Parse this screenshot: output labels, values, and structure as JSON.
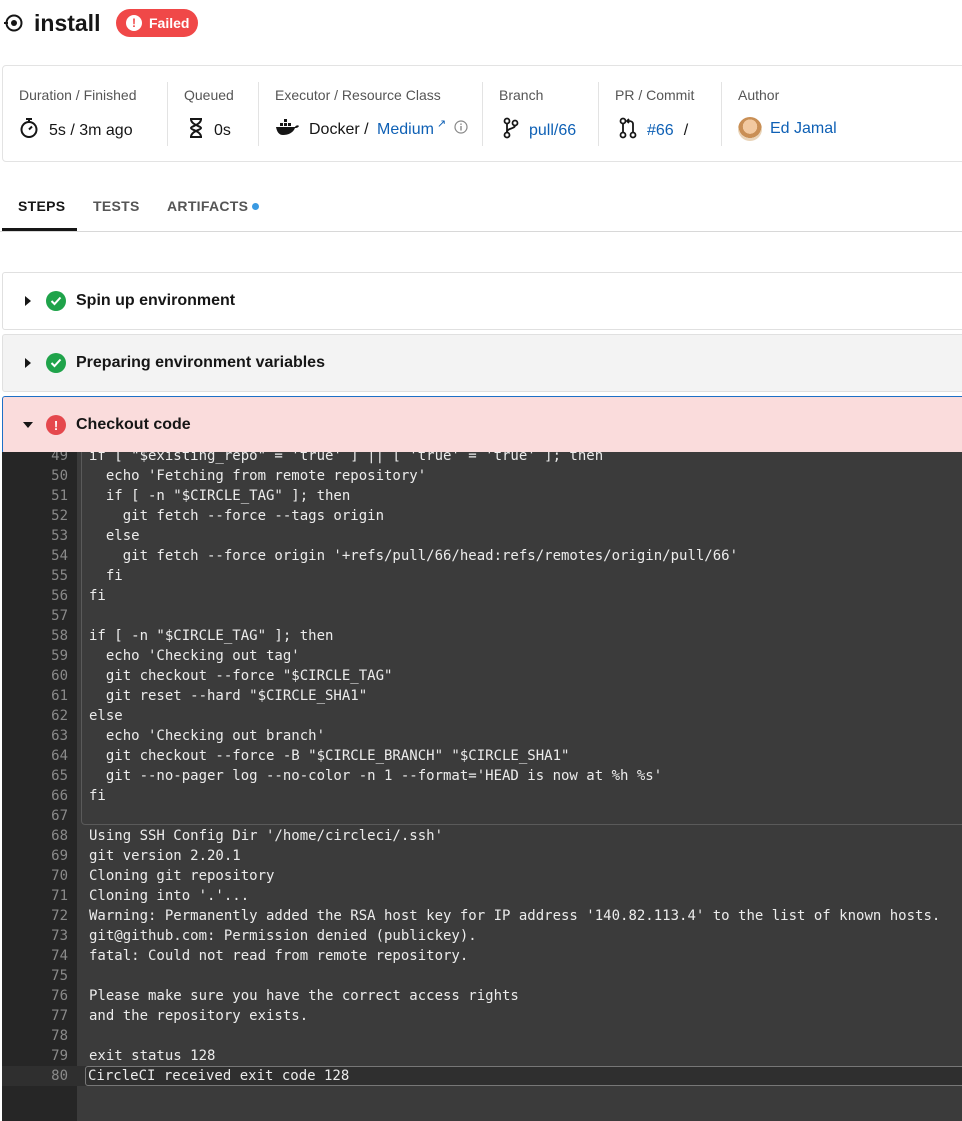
{
  "job": {
    "title": "install",
    "status": "Failed",
    "status_color": "#f04848"
  },
  "info": {
    "duration": {
      "label": "Duration / Finished",
      "value": "5s / 3m ago"
    },
    "queued": {
      "label": "Queued",
      "value": "0s"
    },
    "executor": {
      "label": "Executor / Resource Class",
      "value": "Docker / ",
      "resource_class": "Medium"
    },
    "branch": {
      "label": "Branch",
      "value": "pull/66"
    },
    "pr_commit": {
      "label": "PR / Commit",
      "pr": "#66",
      "sep": "/"
    },
    "author": {
      "label": "Author",
      "name": "Ed Jamal"
    }
  },
  "tabs": [
    {
      "label": "STEPS",
      "active": true
    },
    {
      "label": "TESTS",
      "active": false
    },
    {
      "label": "ARTIFACTS",
      "active": false,
      "has_dot": true
    }
  ],
  "steps": [
    {
      "name": "Spin up environment",
      "status": "success",
      "expanded": false
    },
    {
      "name": "Preparing environment variables",
      "status": "success",
      "expanded": false
    },
    {
      "name": "Checkout code",
      "status": "failed",
      "expanded": true
    }
  ],
  "colors": {
    "success": "#1fa34a",
    "failed": "#e5484d",
    "failed_bg": "#fadcdc",
    "link": "#0e60b5",
    "terminal_bg": "#3b3b3b"
  },
  "log_lines": [
    {
      "n": "49",
      "t": "if [ \"$existing_repo\" = 'true' ] || [ 'true' = 'true' ]; then"
    },
    {
      "n": "50",
      "t": "  echo 'Fetching from remote repository'"
    },
    {
      "n": "51",
      "t": "  if [ -n \"$CIRCLE_TAG\" ]; then"
    },
    {
      "n": "52",
      "t": "    git fetch --force --tags origin"
    },
    {
      "n": "53",
      "t": "  else"
    },
    {
      "n": "54",
      "t": "    git fetch --force origin '+refs/pull/66/head:refs/remotes/origin/pull/66'"
    },
    {
      "n": "55",
      "t": "  fi"
    },
    {
      "n": "56",
      "t": "fi"
    },
    {
      "n": "57",
      "t": ""
    },
    {
      "n": "58",
      "t": "if [ -n \"$CIRCLE_TAG\" ]; then"
    },
    {
      "n": "59",
      "t": "  echo 'Checking out tag'"
    },
    {
      "n": "60",
      "t": "  git checkout --force \"$CIRCLE_TAG\""
    },
    {
      "n": "61",
      "t": "  git reset --hard \"$CIRCLE_SHA1\""
    },
    {
      "n": "62",
      "t": "else"
    },
    {
      "n": "63",
      "t": "  echo 'Checking out branch'"
    },
    {
      "n": "64",
      "t": "  git checkout --force -B \"$CIRCLE_BRANCH\" \"$CIRCLE_SHA1\""
    },
    {
      "n": "65",
      "t": "  git --no-pager log --no-color -n 1 --format='HEAD is now at %h %s'"
    },
    {
      "n": "66",
      "t": "fi"
    },
    {
      "n": "67",
      "t": ""
    },
    {
      "n": "68",
      "t": "Using SSH Config Dir '/home/circleci/.ssh'"
    },
    {
      "n": "69",
      "t": "git version 2.20.1"
    },
    {
      "n": "70",
      "t": "Cloning git repository"
    },
    {
      "n": "71",
      "t": "Cloning into '.'..."
    },
    {
      "n": "72",
      "t": "Warning: Permanently added the RSA host key for IP address '140.82.113.4' to the list of known hosts."
    },
    {
      "n": "73",
      "t": "git@github.com: Permission denied (publickey)."
    },
    {
      "n": "74",
      "t": "fatal: Could not read from remote repository."
    },
    {
      "n": "75",
      "t": ""
    },
    {
      "n": "76",
      "t": "Please make sure you have the correct access rights"
    },
    {
      "n": "77",
      "t": "and the repository exists."
    },
    {
      "n": "78",
      "t": ""
    },
    {
      "n": "79",
      "t": "exit status 128"
    },
    {
      "n": "80",
      "t": "CircleCI received exit code 128"
    }
  ]
}
